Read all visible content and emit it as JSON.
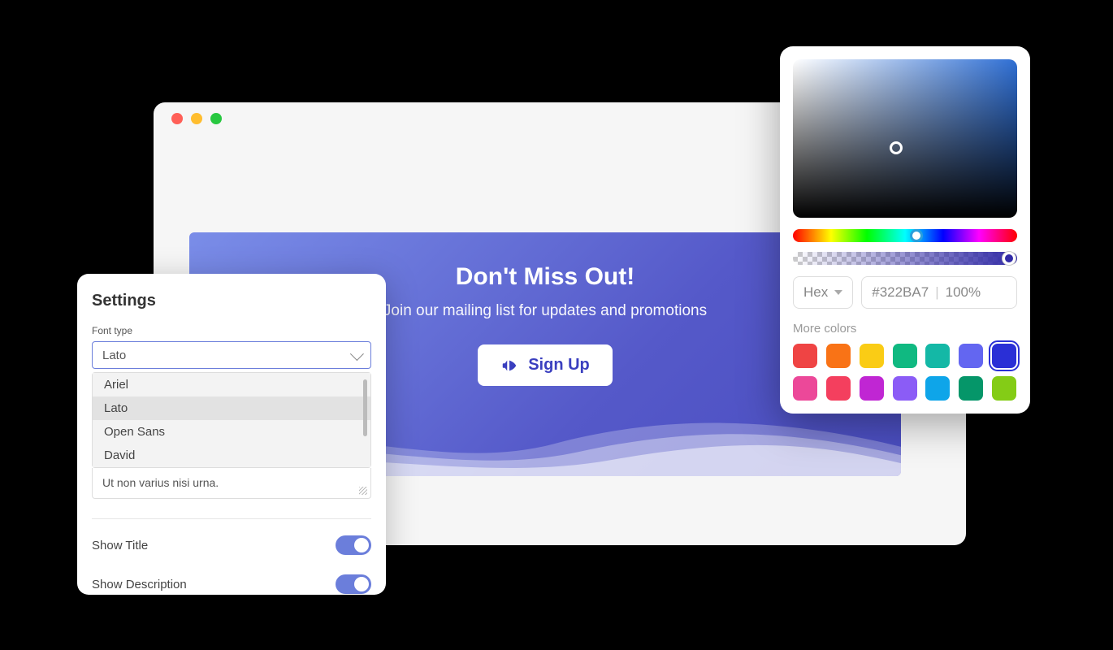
{
  "hero": {
    "title": "Don't Miss Out!",
    "subtitle": "Join our mailing list for updates and promotions",
    "cta_label": "Sign Up"
  },
  "settings": {
    "title": "Settings",
    "font_type_label": "Font type",
    "font_selected": "Lato",
    "font_options": [
      "Ariel",
      "Lato",
      "Open Sans",
      "David"
    ],
    "textarea_value": "Ut non varius nisi urna.",
    "show_title_label": "Show Title",
    "show_title_value": true,
    "show_description_label": "Show Description",
    "show_description_value": true
  },
  "colorpicker": {
    "format_label": "Hex",
    "hex_value": "#322BA7",
    "alpha_value": "100%",
    "more_colors_label": "More colors",
    "swatches": [
      "#ef4444",
      "#f97316",
      "#facc15",
      "#10b981",
      "#14b8a6",
      "#6366f1",
      "#2a2fd6",
      "#ec4899",
      "#f43f5e",
      "#c026d3",
      "#8b5cf6",
      "#0ea5e9",
      "#059669",
      "#84cc16"
    ],
    "selected_swatch_index": 6
  }
}
